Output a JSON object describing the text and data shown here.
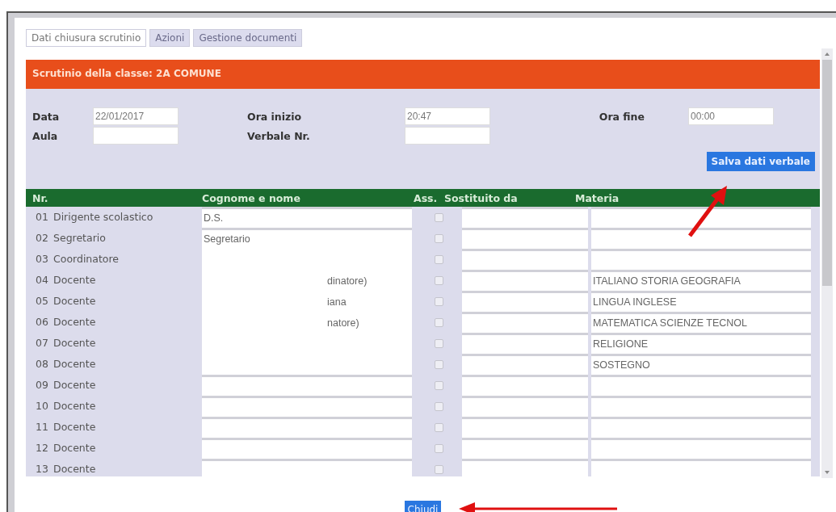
{
  "tabs": [
    {
      "label": "Dati chiusura scrutinio",
      "selected": true
    },
    {
      "label": "Azioni",
      "selected": false
    },
    {
      "label": "Gestione documenti",
      "selected": false
    }
  ],
  "class_title": "Scrutinio della classe: 2A COMUNE",
  "form": {
    "data_label": "Data",
    "data_value": "22/01/2017",
    "ora_inizio_label": "Ora inizio",
    "ora_inizio_value": "20:47",
    "ora_fine_label": "Ora fine",
    "ora_fine_value": "00:00",
    "aula_label": "Aula",
    "verbale_label": "Verbale Nr."
  },
  "save_button": "Salva dati verbale",
  "table": {
    "columns": [
      "Nr.",
      "Cognome e nome",
      "Ass.",
      "Sostituito da",
      "Materia"
    ],
    "rows": [
      {
        "nr": "01",
        "role": "Dirigente scolastico",
        "name": "D.S.",
        "masked": false,
        "absent": false,
        "subject": ""
      },
      {
        "nr": "02",
        "role": "Segretario",
        "name": "Segretario",
        "masked": false,
        "absent": false,
        "subject": ""
      },
      {
        "nr": "03",
        "role": "Coordinatore",
        "name": "",
        "masked": true,
        "absent": false,
        "subject": ""
      },
      {
        "nr": "04",
        "role": "Docente",
        "name": "dinatore)",
        "masked": true,
        "absent": false,
        "subject": "ITALIANO STORIA GEOGRAFIA"
      },
      {
        "nr": "05",
        "role": "Docente",
        "name": "iana",
        "masked": true,
        "absent": false,
        "subject": "LINGUA INGLESE"
      },
      {
        "nr": "06",
        "role": "Docente",
        "name": "natore)",
        "masked": true,
        "absent": false,
        "subject": "MATEMATICA SCIENZE TECNOL"
      },
      {
        "nr": "07",
        "role": "Docente",
        "name": "",
        "masked": true,
        "absent": false,
        "subject": "RELIGIONE"
      },
      {
        "nr": "08",
        "role": "Docente",
        "name": "",
        "masked": true,
        "absent": false,
        "subject": "SOSTEGNO"
      },
      {
        "nr": "09",
        "role": "Docente",
        "name": "",
        "masked": false,
        "absent": false,
        "subject": ""
      },
      {
        "nr": "10",
        "role": "Docente",
        "name": "",
        "masked": false,
        "absent": false,
        "subject": ""
      },
      {
        "nr": "11",
        "role": "Docente",
        "name": "",
        "masked": false,
        "absent": false,
        "subject": ""
      },
      {
        "nr": "12",
        "role": "Docente",
        "name": "",
        "masked": false,
        "absent": false,
        "subject": ""
      },
      {
        "nr": "13",
        "role": "Docente",
        "name": "",
        "masked": false,
        "absent": false,
        "subject": ""
      }
    ]
  },
  "close_button": "Chiudi"
}
